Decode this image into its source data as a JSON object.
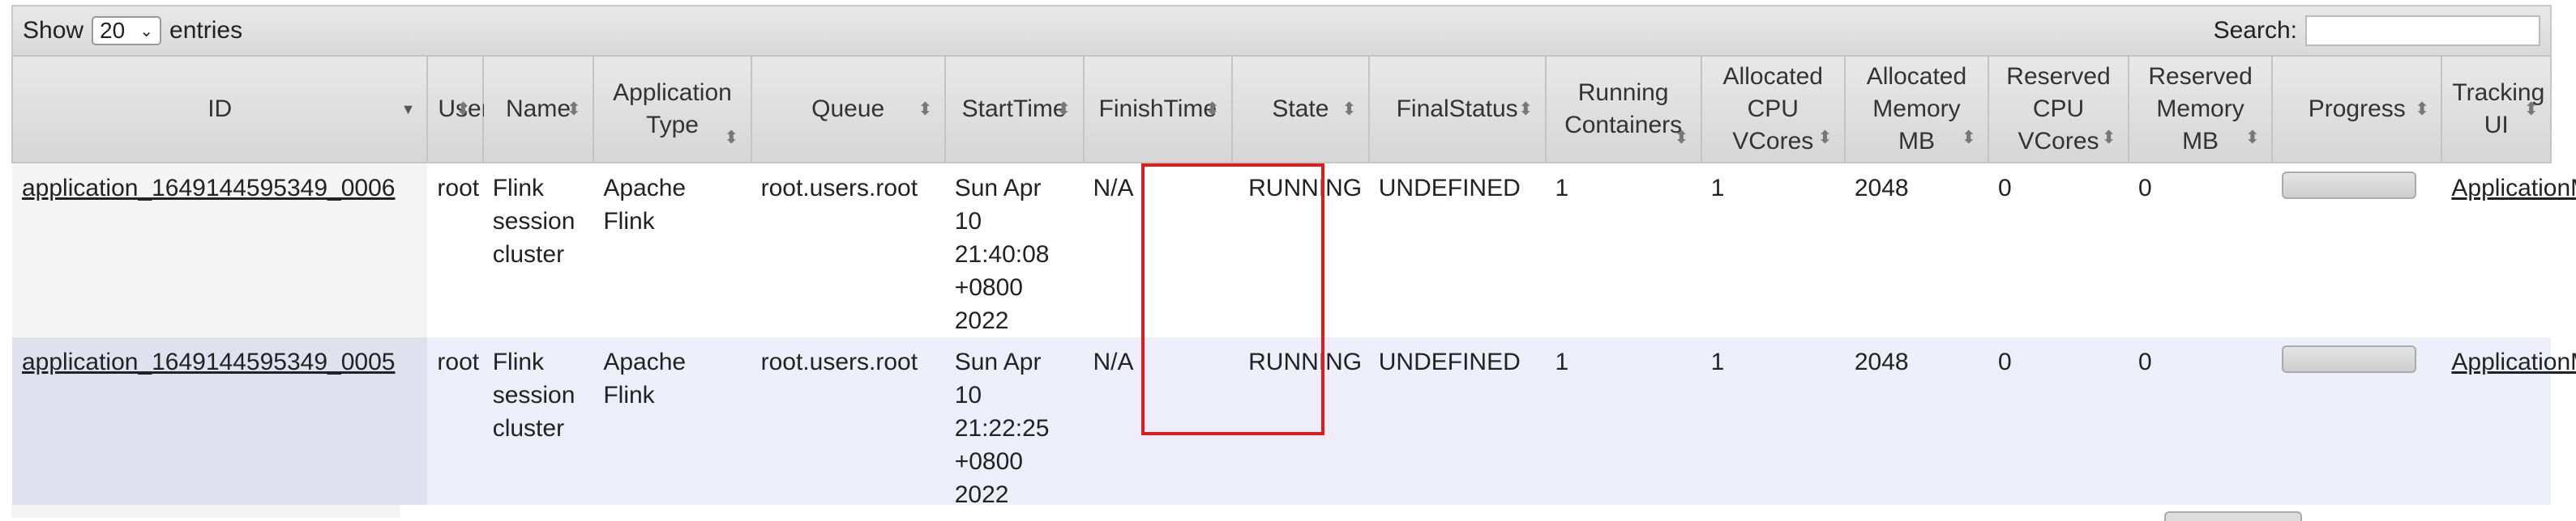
{
  "toolbar": {
    "show_label": "Show",
    "page_size": "20",
    "entries_label": "entries",
    "search_label": "Search:",
    "search_value": ""
  },
  "columns": [
    {
      "key": "id",
      "lines": [
        "ID"
      ],
      "sort": "desc"
    },
    {
      "key": "user",
      "lines": [
        "User"
      ],
      "sort": "both"
    },
    {
      "key": "name",
      "lines": [
        "Name"
      ],
      "sort": "both"
    },
    {
      "key": "type",
      "lines": [
        "Application",
        "Type"
      ],
      "sort": "both"
    },
    {
      "key": "queue",
      "lines": [
        "Queue"
      ],
      "sort": "both"
    },
    {
      "key": "start",
      "lines": [
        "StartTime"
      ],
      "sort": "both"
    },
    {
      "key": "finish",
      "lines": [
        "FinishTime"
      ],
      "sort": "both"
    },
    {
      "key": "state",
      "lines": [
        "State"
      ],
      "sort": "both"
    },
    {
      "key": "final",
      "lines": [
        "FinalStatus"
      ],
      "sort": "both"
    },
    {
      "key": "containers",
      "lines": [
        "Running",
        "Containers"
      ],
      "sort": "both"
    },
    {
      "key": "cpu",
      "lines": [
        "Allocated",
        "CPU",
        "VCores"
      ],
      "sort": "both"
    },
    {
      "key": "mem",
      "lines": [
        "Allocated",
        "Memory",
        "MB"
      ],
      "sort": "both"
    },
    {
      "key": "rcpu",
      "lines": [
        "Reserved",
        "CPU",
        "VCores"
      ],
      "sort": "both"
    },
    {
      "key": "rmem",
      "lines": [
        "Reserved",
        "Memory",
        "MB"
      ],
      "sort": "both"
    },
    {
      "key": "progress",
      "lines": [
        "Progress"
      ],
      "sort": "both"
    },
    {
      "key": "tracking",
      "lines": [
        "Tracking UI"
      ],
      "sort": "both"
    }
  ],
  "rows": [
    {
      "id": "application_1649144595349_0006",
      "user": "root",
      "name": [
        "Flink",
        "session",
        "cluster"
      ],
      "type": [
        "Apache",
        "Flink"
      ],
      "queue": "root.users.root",
      "start": [
        "Sun Apr",
        "10",
        "21:40:08",
        "+0800",
        "2022"
      ],
      "finish": "N/A",
      "state": "RUNNING",
      "final": "UNDEFINED",
      "containers": "1",
      "cpu": "1",
      "mem": "2048",
      "rcpu": "0",
      "rmem": "0",
      "progress": 0,
      "tracking": "ApplicationMaster"
    },
    {
      "id": "application_1649144595349_0005",
      "user": "root",
      "name": [
        "Flink",
        "session",
        "cluster"
      ],
      "type": [
        "Apache",
        "Flink"
      ],
      "queue": "root.users.root",
      "start": [
        "Sun Apr",
        "10",
        "21:22:25",
        "+0800",
        "2022"
      ],
      "finish": "N/A",
      "state": "RUNNING",
      "final": "UNDEFINED",
      "containers": "1",
      "cpu": "1",
      "mem": "2048",
      "rcpu": "0",
      "rmem": "0",
      "progress": 0,
      "tracking": "ApplicationMaster"
    }
  ],
  "colors": {
    "highlight_border": "#e01b1b",
    "odd_row": "#ffffff",
    "even_row": "#eeeefa"
  },
  "icons": {
    "sort_both": "sort-both-icon",
    "sort_desc": "sort-desc-icon",
    "select_chevron": "chevron-down-icon"
  }
}
